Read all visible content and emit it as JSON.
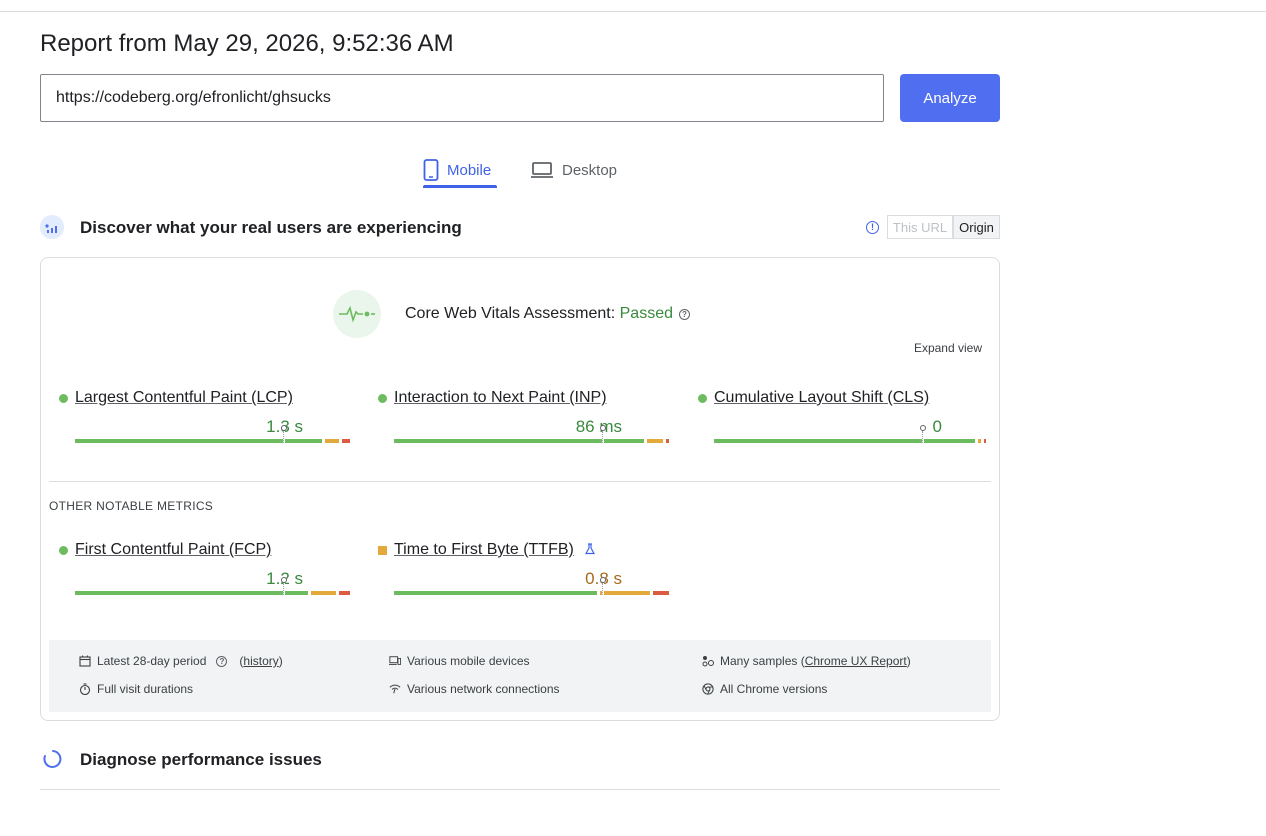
{
  "report": {
    "title": "Report from May 29, 2026, 9:52:36 AM"
  },
  "search": {
    "url": "https://codeberg.org/efronlicht/ghsucks",
    "analyze_label": "Analyze"
  },
  "tabs": {
    "mobile": "Mobile",
    "desktop": "Desktop",
    "active": "Mobile"
  },
  "field": {
    "title": "Discover what your real users are experiencing",
    "toggle_url": "This URL",
    "toggle_origin": "Origin",
    "selected": "Origin"
  },
  "cwv": {
    "label": "Core Web Vitals Assessment:",
    "status": "Passed",
    "help": "?",
    "expand": "Expand view"
  },
  "metrics": [
    {
      "name": "Largest Contentful Paint (LCP)",
      "value": "1.3 s",
      "status": "good",
      "marker_pos": 0.75,
      "dist": [
        0.9,
        0.06,
        0.04
      ]
    },
    {
      "name": "Interaction to Next Paint (INP)",
      "value": "86 ms",
      "status": "good",
      "marker_pos": 0.75,
      "dist": [
        0.91,
        0.07,
        0.02
      ]
    },
    {
      "name": "Cumulative Layout Shift (CLS)",
      "value": "0",
      "status": "good",
      "marker_pos": 0.75,
      "dist": [
        0.95,
        0.02,
        0.02
      ]
    }
  ],
  "other": {
    "label": "OTHER NOTABLE METRICS",
    "metrics": [
      {
        "name": "First Contentful Paint (FCP)",
        "value": "1.2 s",
        "status": "good",
        "marker_pos": 0.75,
        "dist": [
          0.85,
          0.1,
          0.05
        ]
      },
      {
        "name": "Time to First Byte (TTFB)",
        "value": "0.8 s",
        "status": "needs-improvement",
        "marker_pos": 0.75,
        "dist": [
          0.74,
          0.19,
          0.07
        ],
        "experimental": true
      }
    ]
  },
  "footer": {
    "period": "Latest 28-day period",
    "history": "history",
    "devices": "Various mobile devices",
    "samples_prefix": "Many samples (",
    "samples_link": "Chrome UX Report",
    "samples_suffix": ")",
    "durations": "Full visit durations",
    "network": "Various network connections",
    "versions": "All Chrome versions"
  },
  "diagnose": {
    "title": "Diagnose performance issues"
  },
  "colors": {
    "accent": "#4f6ff0",
    "good": "#6dbb5f",
    "average": "#e3a93a",
    "poor": "#dd5a43",
    "pass_text": "#3a8a3d"
  }
}
